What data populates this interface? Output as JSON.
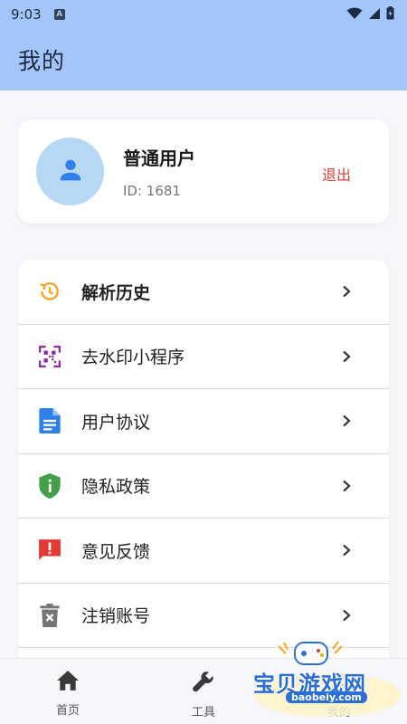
{
  "status_bar": {
    "time": "9:03",
    "badge": "A"
  },
  "app_bar": {
    "title": "我的"
  },
  "profile": {
    "name": "普通用户",
    "id_text": "ID: 1681",
    "logout_label": "退出"
  },
  "menu": {
    "items": [
      {
        "label": "解析历史",
        "icon": "history-icon",
        "color": "#f5a623"
      },
      {
        "label": "去水印小程序",
        "icon": "qr-code-icon",
        "color": "#8e24aa"
      },
      {
        "label": "用户协议",
        "icon": "document-icon",
        "color": "#2f80ed"
      },
      {
        "label": "隐私政策",
        "icon": "shield-icon",
        "color": "#43a047"
      },
      {
        "label": "意见反馈",
        "icon": "feedback-icon",
        "color": "#e53935"
      },
      {
        "label": "注销账号",
        "icon": "delete-icon",
        "color": "#757575"
      }
    ]
  },
  "bottom_nav": {
    "items": [
      {
        "label": "首页",
        "icon": "home-icon"
      },
      {
        "label": "工具",
        "icon": "wrench-icon"
      },
      {
        "label": "我的",
        "icon": "person-icon"
      }
    ]
  },
  "watermark": {
    "text": "宝贝游戏网",
    "url": "baobeiy.com"
  },
  "colors": {
    "header_bg": "#a3c5f9",
    "accent": "#2f80ed",
    "logout": "#e53935"
  }
}
